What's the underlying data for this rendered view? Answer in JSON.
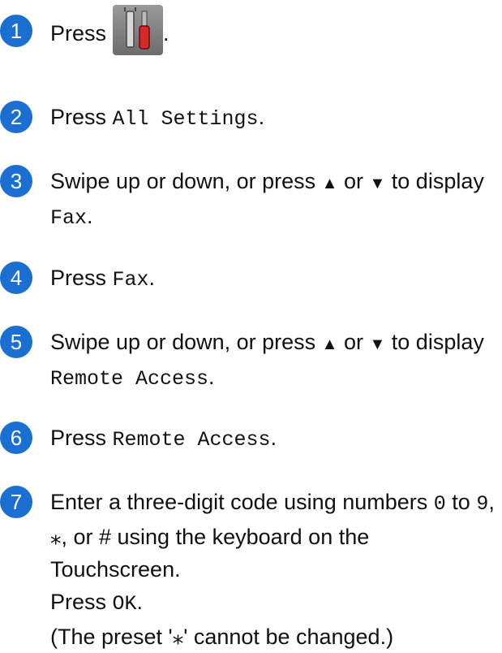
{
  "steps": [
    {
      "number": "1",
      "parts": {
        "a": "Press",
        "b": "."
      },
      "icon": "settings-icon"
    },
    {
      "number": "2",
      "parts": {
        "a": "Press ",
        "b": "All Settings",
        "c": "."
      }
    },
    {
      "number": "3",
      "parts": {
        "a": "Swipe up or down, or press ",
        "b": "▲",
        "c": " or ",
        "d": "▼",
        "e": " to display ",
        "f": "Fax",
        "g": "."
      }
    },
    {
      "number": "4",
      "parts": {
        "a": "Press ",
        "b": "Fax",
        "c": "."
      }
    },
    {
      "number": "5",
      "parts": {
        "a": "Swipe up or down, or press ",
        "b": "▲",
        "c": " or ",
        "d": "▼",
        "e": " to display ",
        "f": "Remote Access",
        "g": "."
      }
    },
    {
      "number": "6",
      "parts": {
        "a": "Press ",
        "b": "Remote Access",
        "c": "."
      }
    },
    {
      "number": "7",
      "parts": {
        "a": "Enter a three-digit code using numbers ",
        "b": "0",
        "c": " to ",
        "d": "9",
        "e": ", ",
        "f": "⁎",
        "g": ", or # using the keyboard on the Touchscreen.",
        "h": "Press ",
        "i": "OK",
        "j": ".",
        "k": "(The preset '⁎' cannot be changed.)"
      }
    }
  ],
  "colors": {
    "step_number_bg": "#1a6fd1",
    "text": "#111111"
  }
}
